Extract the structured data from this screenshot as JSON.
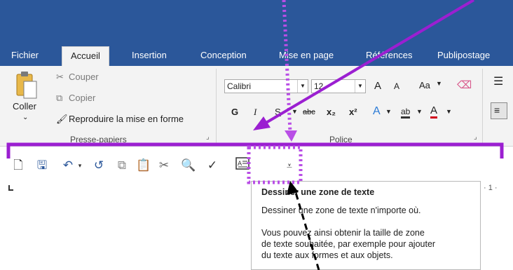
{
  "tabs": [
    {
      "label": "Fichier"
    },
    {
      "label": "Accueil",
      "active": true
    },
    {
      "label": "Insertion"
    },
    {
      "label": "Conception"
    },
    {
      "label": "Mise en page"
    },
    {
      "label": "Références"
    },
    {
      "label": "Publipostage"
    }
  ],
  "clipboard": {
    "paste_label": "Coller",
    "cut_label": "Couper",
    "copy_label": "Copier",
    "format_painter_label": "Reproduire la mise en forme",
    "group_label": "Presse-papiers"
  },
  "font": {
    "font_name": "Calibri",
    "font_size": "12",
    "grow_label": "A",
    "shrink_label": "A",
    "case_label": "Aa",
    "bold_label": "G",
    "italic_label": "I",
    "underline_label": "S",
    "strike_label": "abc",
    "subscript_label": "x₂",
    "superscript_label": "x²",
    "effects_label": "A",
    "highlight_label": "ab",
    "color_label": "A",
    "group_label": "Police"
  },
  "tooltip": {
    "title": "Dessiner une zone de texte",
    "line1": "Dessiner une zone de texte n'importe où.",
    "line2": "Vous pouvez ainsi obtenir la taille de zone",
    "line3": "de texte souhaitée, par exemple pour ajouter",
    "line4": "du texte aux formes et aux objets."
  },
  "ruler_text": "· 1 ·",
  "colors": {
    "ribbon_blue": "#2b579a",
    "annotation_purple": "#9b1fd1",
    "highlight_dotted": "#b94ee6",
    "arrow_black": "#000000"
  }
}
